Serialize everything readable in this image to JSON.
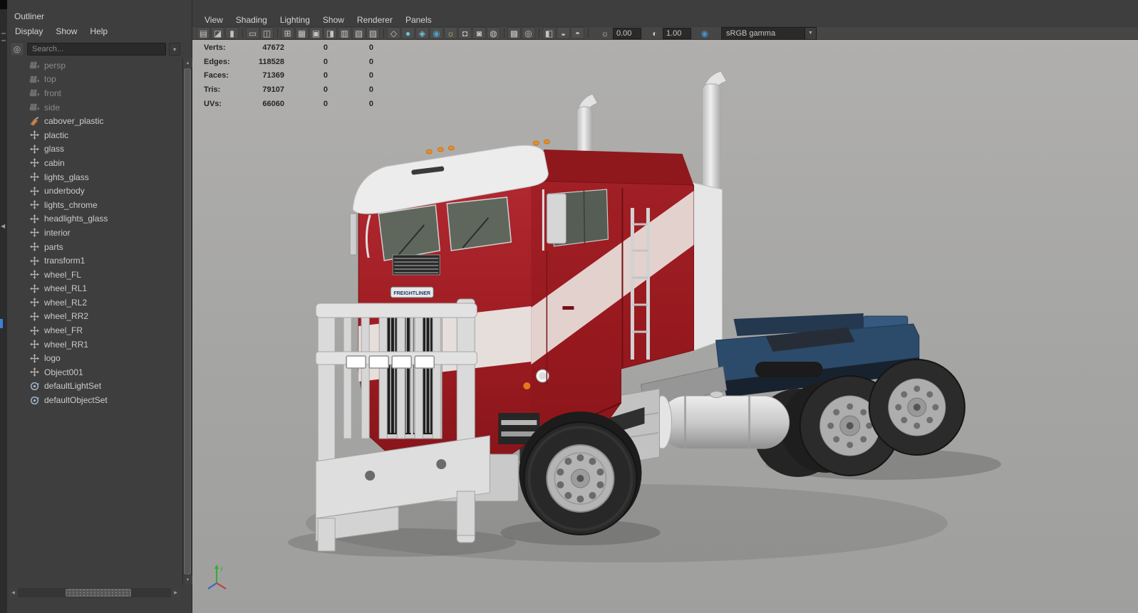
{
  "window": {
    "collapse_arrow": "◀",
    "colors": {
      "ui_bg": "#3e3e3e",
      "toolbar_bg": "#464646",
      "viewport_bg": "#a8a8a6",
      "truck_red": "#a01d23",
      "chassis_blue": "#2c4a6a",
      "stripe_white": "#e6d8d5",
      "marker_orange": "#f08a1e",
      "hud_text": "#262626"
    }
  },
  "outliner": {
    "title": "Outliner",
    "menus": [
      "Display",
      "Show",
      "Help"
    ],
    "search_placeholder": "Search...",
    "search_dropdown_arrow": "▾",
    "scroll": {
      "up": "▲",
      "down": "▼",
      "left": "◀",
      "right": "▶"
    },
    "items": [
      {
        "label": "persp",
        "icon": "camera-icon",
        "dimmed": true
      },
      {
        "label": "top",
        "icon": "camera-icon",
        "dimmed": true
      },
      {
        "label": "front",
        "icon": "camera-icon",
        "dimmed": true
      },
      {
        "label": "side",
        "icon": "camera-icon",
        "dimmed": true
      },
      {
        "label": "cabover_plastic",
        "icon": "material-icon",
        "dimmed": false
      },
      {
        "label": "plactic",
        "icon": "transform-icon",
        "dimmed": false
      },
      {
        "label": "glass",
        "icon": "transform-icon",
        "dimmed": false
      },
      {
        "label": "cabin",
        "icon": "transform-icon",
        "dimmed": false
      },
      {
        "label": "lights_glass",
        "icon": "transform-icon",
        "dimmed": false
      },
      {
        "label": "underbody",
        "icon": "transform-icon",
        "dimmed": false
      },
      {
        "label": "lights_chrome",
        "icon": "transform-icon",
        "dimmed": false
      },
      {
        "label": "headlights_glass",
        "icon": "transform-icon",
        "dimmed": false
      },
      {
        "label": "interior",
        "icon": "transform-icon",
        "dimmed": false
      },
      {
        "label": "parts",
        "icon": "transform-icon",
        "dimmed": false
      },
      {
        "label": "transform1",
        "icon": "transform-icon",
        "dimmed": false
      },
      {
        "label": "wheel_FL",
        "icon": "transform-icon",
        "dimmed": false
      },
      {
        "label": "wheel_RL1",
        "icon": "transform-icon",
        "dimmed": false
      },
      {
        "label": "wheel_RL2",
        "icon": "transform-icon",
        "dimmed": false
      },
      {
        "label": "wheel_RR2",
        "icon": "transform-icon",
        "dimmed": false
      },
      {
        "label": "wheel_FR",
        "icon": "transform-icon",
        "dimmed": false
      },
      {
        "label": "wheel_RR1",
        "icon": "transform-icon",
        "dimmed": false
      },
      {
        "label": "logo",
        "icon": "transform-icon",
        "dimmed": false
      },
      {
        "label": "Object001",
        "icon": "transform-icon",
        "dimmed": false
      },
      {
        "label": "defaultLightSet",
        "icon": "set-icon",
        "dimmed": false
      },
      {
        "label": "defaultObjectSet",
        "icon": "set-icon",
        "dimmed": false
      }
    ]
  },
  "viewport": {
    "menus": [
      "View",
      "Shading",
      "Lighting",
      "Show",
      "Renderer",
      "Panels"
    ],
    "toolbar": {
      "icons": [
        {
          "name": "select-camera-icon",
          "glyph": "▤"
        },
        {
          "name": "camera-attributes-icon",
          "glyph": "◪"
        },
        {
          "name": "bookmarks-icon",
          "glyph": "▮",
          "sep": true
        },
        {
          "name": "image-plane-icon",
          "glyph": "▭"
        },
        {
          "name": "2d-pan-zoom-icon",
          "glyph": "◫",
          "sep": true
        },
        {
          "name": "grid-icon",
          "glyph": "⊞"
        },
        {
          "name": "film-gate-icon",
          "glyph": "▦"
        },
        {
          "name": "resolution-gate-icon",
          "glyph": "▣"
        },
        {
          "name": "gate-mask-icon",
          "glyph": "◨"
        },
        {
          "name": "field-chart-icon",
          "glyph": "▥"
        },
        {
          "name": "safe-action-icon",
          "glyph": "▧"
        },
        {
          "name": "safe-title-icon",
          "glyph": "▨",
          "sep": true
        },
        {
          "name": "wireframe-icon",
          "glyph": "◇"
        },
        {
          "name": "smooth-shade-icon",
          "glyph": "●",
          "color": "#6fc2cf"
        },
        {
          "name": "bounding-box-icon",
          "glyph": "◈",
          "color": "#6fc2cf"
        },
        {
          "name": "textured-icon",
          "glyph": "◉",
          "color": "#4f9ec4"
        },
        {
          "name": "use-all-lights-icon",
          "glyph": "☼",
          "color": "#d8c878"
        },
        {
          "name": "shadows-icon",
          "glyph": "◘"
        },
        {
          "name": "ambient-occlusion-icon",
          "glyph": "◙"
        },
        {
          "name": "motion-blur-icon",
          "glyph": "◍",
          "sep": true
        },
        {
          "name": "multisample-icon",
          "glyph": "▩"
        },
        {
          "name": "depth-of-field-icon",
          "glyph": "◎",
          "sep": true
        },
        {
          "name": "isolate-select-icon",
          "glyph": "◧"
        },
        {
          "name": "xray-icon",
          "glyph": "◒"
        },
        {
          "name": "joint-xray-icon",
          "glyph": "◓",
          "sep": true
        }
      ],
      "exposure_icon": "☼",
      "exposure_value": "0.00",
      "contrast_icon": "◐",
      "contrast_value": "1.00",
      "color_management_icon": "◉",
      "view_transform": "sRGB gamma",
      "dropdown_arrow": "▼"
    },
    "hud": {
      "rows": [
        {
          "label": "Verts:",
          "v1": "47672",
          "v2": "0",
          "v3": "0"
        },
        {
          "label": "Edges:",
          "v1": "118528",
          "v2": "0",
          "v3": "0"
        },
        {
          "label": "Faces:",
          "v1": "71369",
          "v2": "0",
          "v3": "0"
        },
        {
          "label": "Tris:",
          "v1": "79107",
          "v2": "0",
          "v3": "0"
        },
        {
          "label": "UVs:",
          "v1": "66060",
          "v2": "0",
          "v3": "0"
        }
      ]
    },
    "model_name": "FREIGHTLINER"
  }
}
